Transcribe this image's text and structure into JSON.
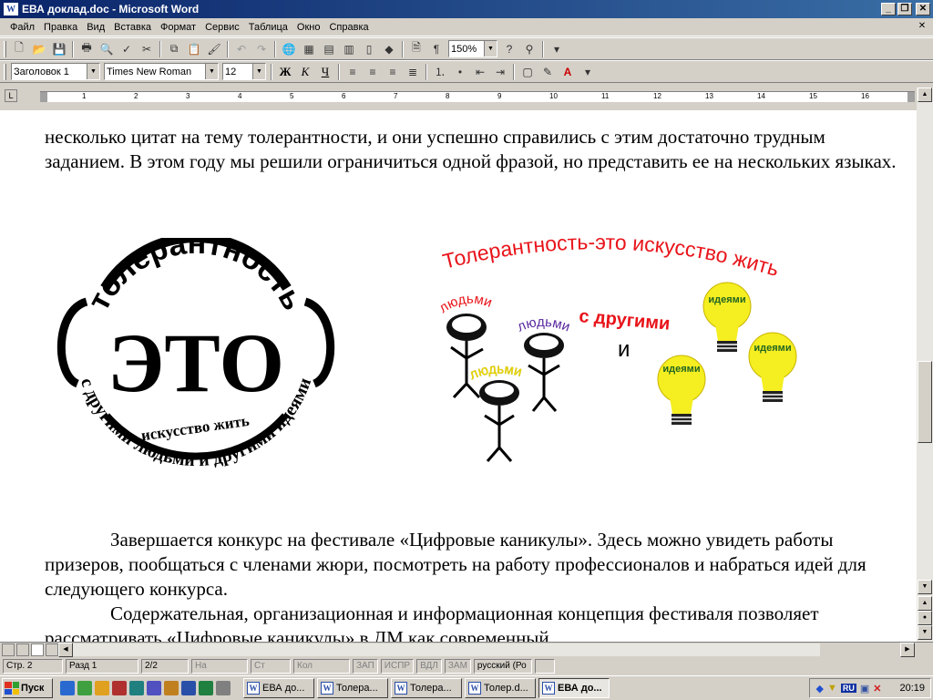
{
  "window": {
    "title": "ЕВА доклад.doc - Microsoft Word",
    "app_icon": "W"
  },
  "menu": [
    "Файл",
    "Правка",
    "Вид",
    "Вставка",
    "Формат",
    "Сервис",
    "Таблица",
    "Окно",
    "Справка"
  ],
  "toolbar": {
    "zoom": "150%"
  },
  "format": {
    "style": "Заголовок 1",
    "font": "Times New Roman",
    "size": "12",
    "bold": "Ж",
    "italic": "К",
    "underline": "Ч"
  },
  "ruler": {
    "ticks": [
      "1",
      "2",
      "3",
      "4",
      "5",
      "6",
      "7",
      "8",
      "9",
      "10",
      "11",
      "12",
      "13",
      "14",
      "15",
      "16"
    ]
  },
  "document": {
    "para1": "несколько цитат на тему толерантности,  и они успешно справились с этим достаточно трудным заданием. В этом году мы решили ограничиться одной фразой, но представить ее на нескольких языках.",
    "para2": "Завершается конкурс на фестивале «Цифровые каникулы». Здесь можно увидеть работы призеров, пообщаться с членами жюри, посмотреть на работу профессионалов и набраться идей для следующего конкурса.",
    "para3": "Содержательная, организационная и информационная концепция фестиваля позволяет рассматривать «Цифровые каникулы» в ДМ как современный"
  },
  "logo1": {
    "top_arc": "толерантность",
    "center": "ЭТО",
    "middle": "искусство жить",
    "bottom_arc": "с другими людьми и другими идеями"
  },
  "logo2": {
    "headline": "Толерантность-это искусство жить",
    "with_others": "с другими",
    "people": "людьми",
    "and": "и",
    "ideas": "идеями",
    "colors": {
      "red": "#e8141a",
      "purple": "#5a2aa0",
      "yellow": "#f2e300"
    }
  },
  "status": {
    "page": "Стр. 2",
    "section": "Разд 1",
    "pages": "2/2",
    "at": "На",
    "line": "Ст",
    "col": "Кол",
    "rec": "ЗАП",
    "trk": "ИСПР",
    "ext": "ВДЛ",
    "ovr": "ЗАМ",
    "language": "русский (Ро"
  },
  "taskbar": {
    "start": "Пуск",
    "buttons": [
      "ЕВА до...",
      "Толера...",
      "Толера...",
      "Толер.d...",
      "ЕВА до..."
    ],
    "lang": "RU",
    "clock": "20:19"
  }
}
